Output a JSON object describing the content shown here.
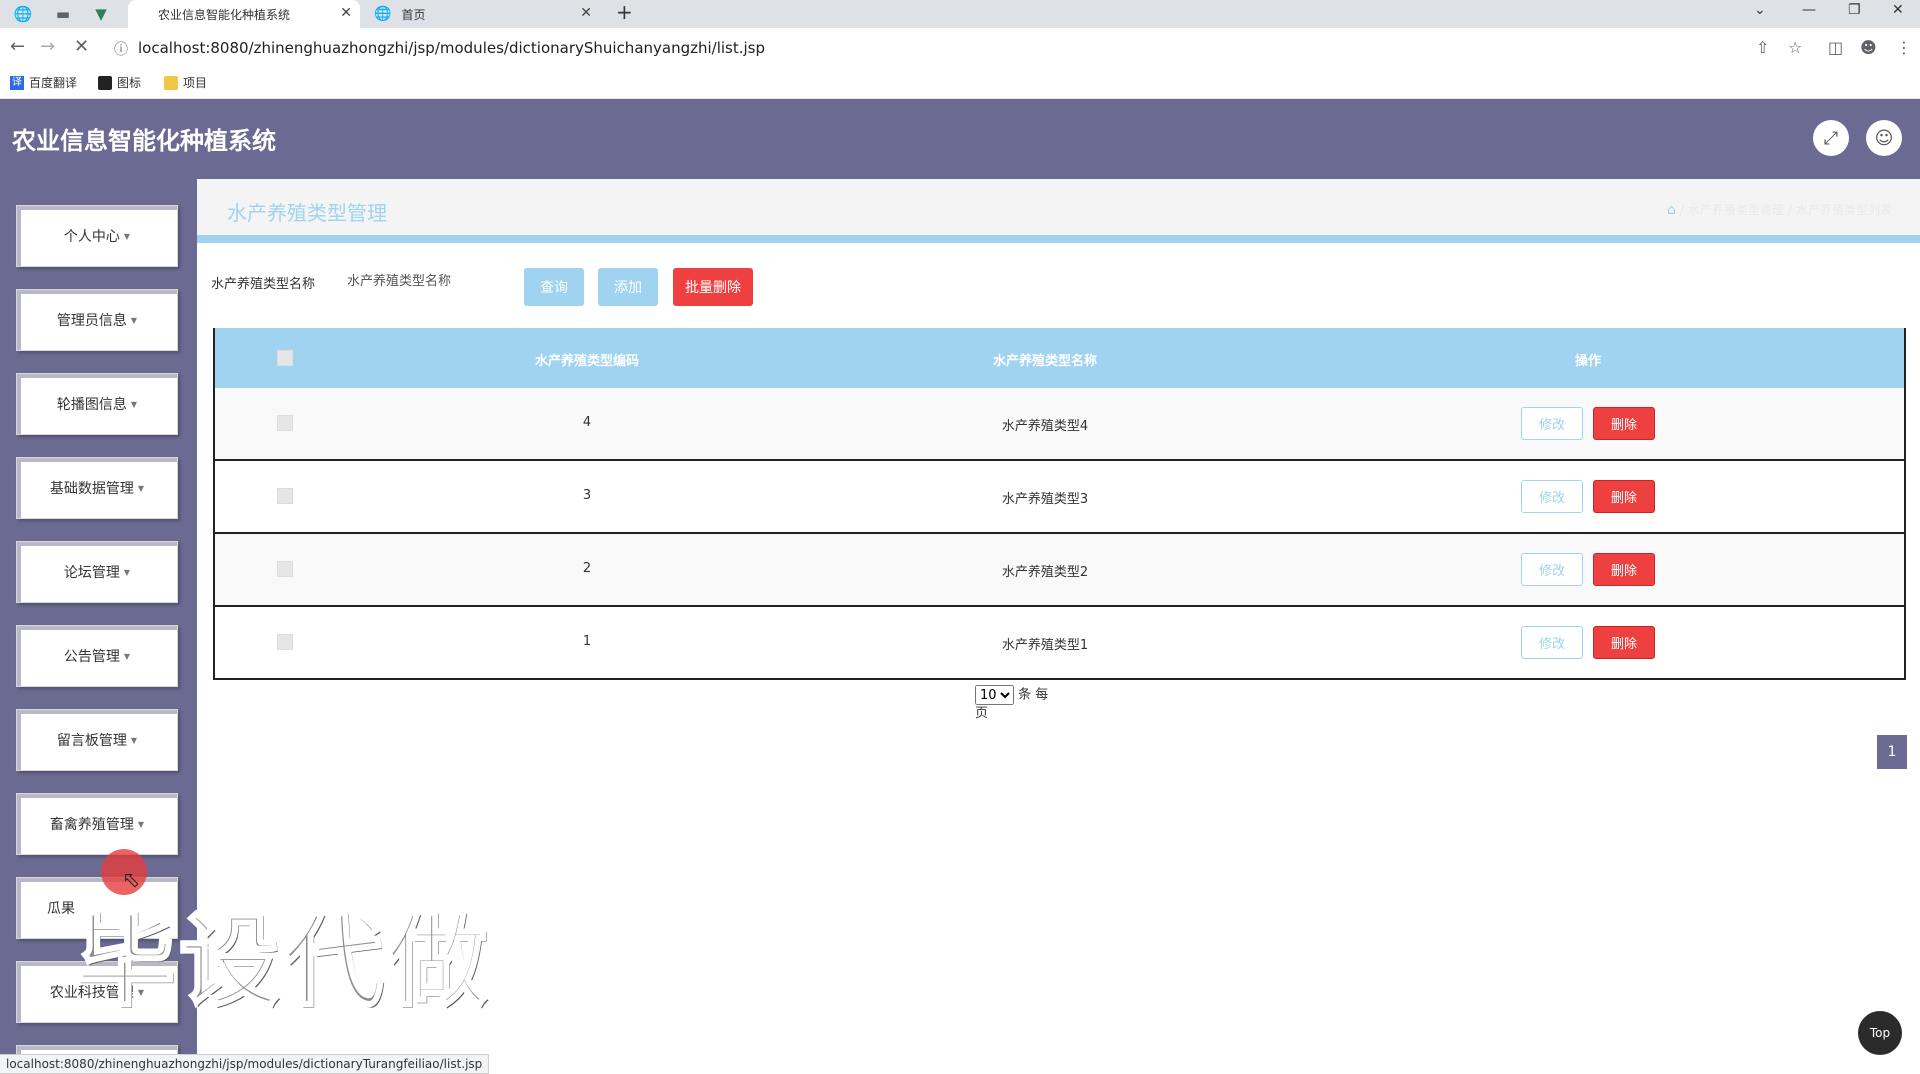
{
  "browser": {
    "tabs": [
      {
        "label": "农业信息智能化种植系统",
        "active": true
      },
      {
        "label": "首页",
        "active": false
      }
    ],
    "url": "localhost:8080/zhinenghuazhongzhi/jsp/modules/dictionaryShuichanyangzhi/list.jsp",
    "bookmarks": [
      "百度翻译",
      "图标",
      "项目"
    ],
    "status_url": "localhost:8080/zhinenghuazhongzhi/jsp/modules/dictionaryTurangfeiliao/list.jsp"
  },
  "app": {
    "title": "农业信息智能化种植系统"
  },
  "sidebar": {
    "items": [
      {
        "label": "个人中心"
      },
      {
        "label": "管理员信息"
      },
      {
        "label": "轮播图信息"
      },
      {
        "label": "基础数据管理"
      },
      {
        "label": "论坛管理"
      },
      {
        "label": "公告管理"
      },
      {
        "label": "留言板管理"
      },
      {
        "label": "畜禽养殖管理"
      },
      {
        "label": "瓜果"
      },
      {
        "label": "农业科技管理"
      }
    ]
  },
  "page": {
    "title": "水产养殖类型管理",
    "breadcrumb": [
      "水产养殖类型管理",
      "水产养殖类型列表"
    ]
  },
  "search": {
    "label": "水产养殖类型名称",
    "placeholder": "水产养殖类型名称",
    "query_label": "查询",
    "add_label": "添加",
    "batch_delete_label": "批量删除"
  },
  "table": {
    "headers": [
      "水产养殖类型编码",
      "水产养殖类型名称",
      "操作"
    ],
    "rows": [
      {
        "code": "4",
        "name": "水产养殖类型4"
      },
      {
        "code": "3",
        "name": "水产养殖类型3"
      },
      {
        "code": "2",
        "name": "水产养殖类型2"
      },
      {
        "code": "1",
        "name": "水产养殖类型1"
      }
    ],
    "edit_label": "修改",
    "delete_label": "删除"
  },
  "pagination": {
    "page_size": "10",
    "per_page_text": "条 每",
    "page_text": "页",
    "current_page": "1"
  },
  "top_button": "Top",
  "watermark": "毕设代做",
  "colors": {
    "header_bg": "#6b6a92",
    "accent_blue": "#9fd3ef",
    "danger_red": "#ee4040"
  }
}
